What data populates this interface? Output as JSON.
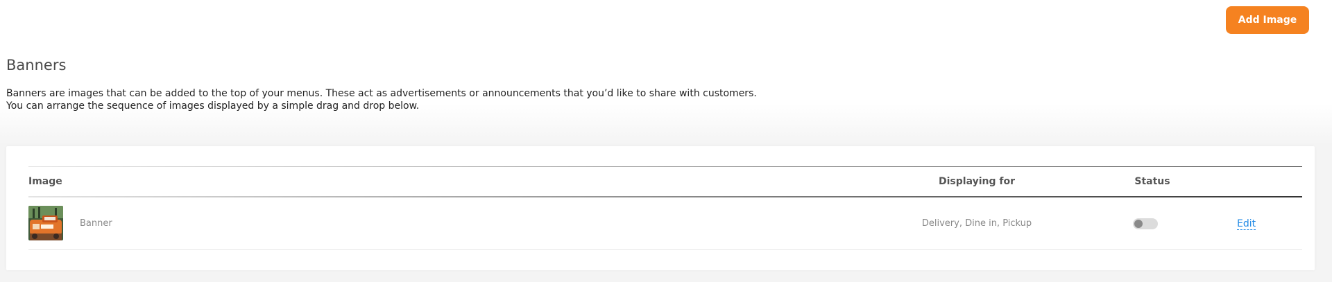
{
  "toolbar": {
    "add_image_label": "Add Image",
    "accent_color": "#f58220"
  },
  "section": {
    "title": "Banners",
    "description_line1": "Banners are images that can be added to the top of your menus. These act as advertisements or announcements that you’d like to share with customers.",
    "description_line2": "You can arrange the sequence of images displayed by a simple drag and drop below."
  },
  "table": {
    "headers": {
      "image": "Image",
      "displaying_for": "Displaying for",
      "status": "Status"
    },
    "rows": [
      {
        "thumbnail_icon": "banner-image-thumbnail",
        "name": "Banner",
        "displaying_for": "Delivery, Dine in, Pickup",
        "status_enabled": false,
        "edit_label": "Edit"
      }
    ]
  },
  "colors": {
    "link": "#1e88e5",
    "toggle_off_track": "#dcdcdc",
    "toggle_off_knob": "#8a8a8a"
  }
}
